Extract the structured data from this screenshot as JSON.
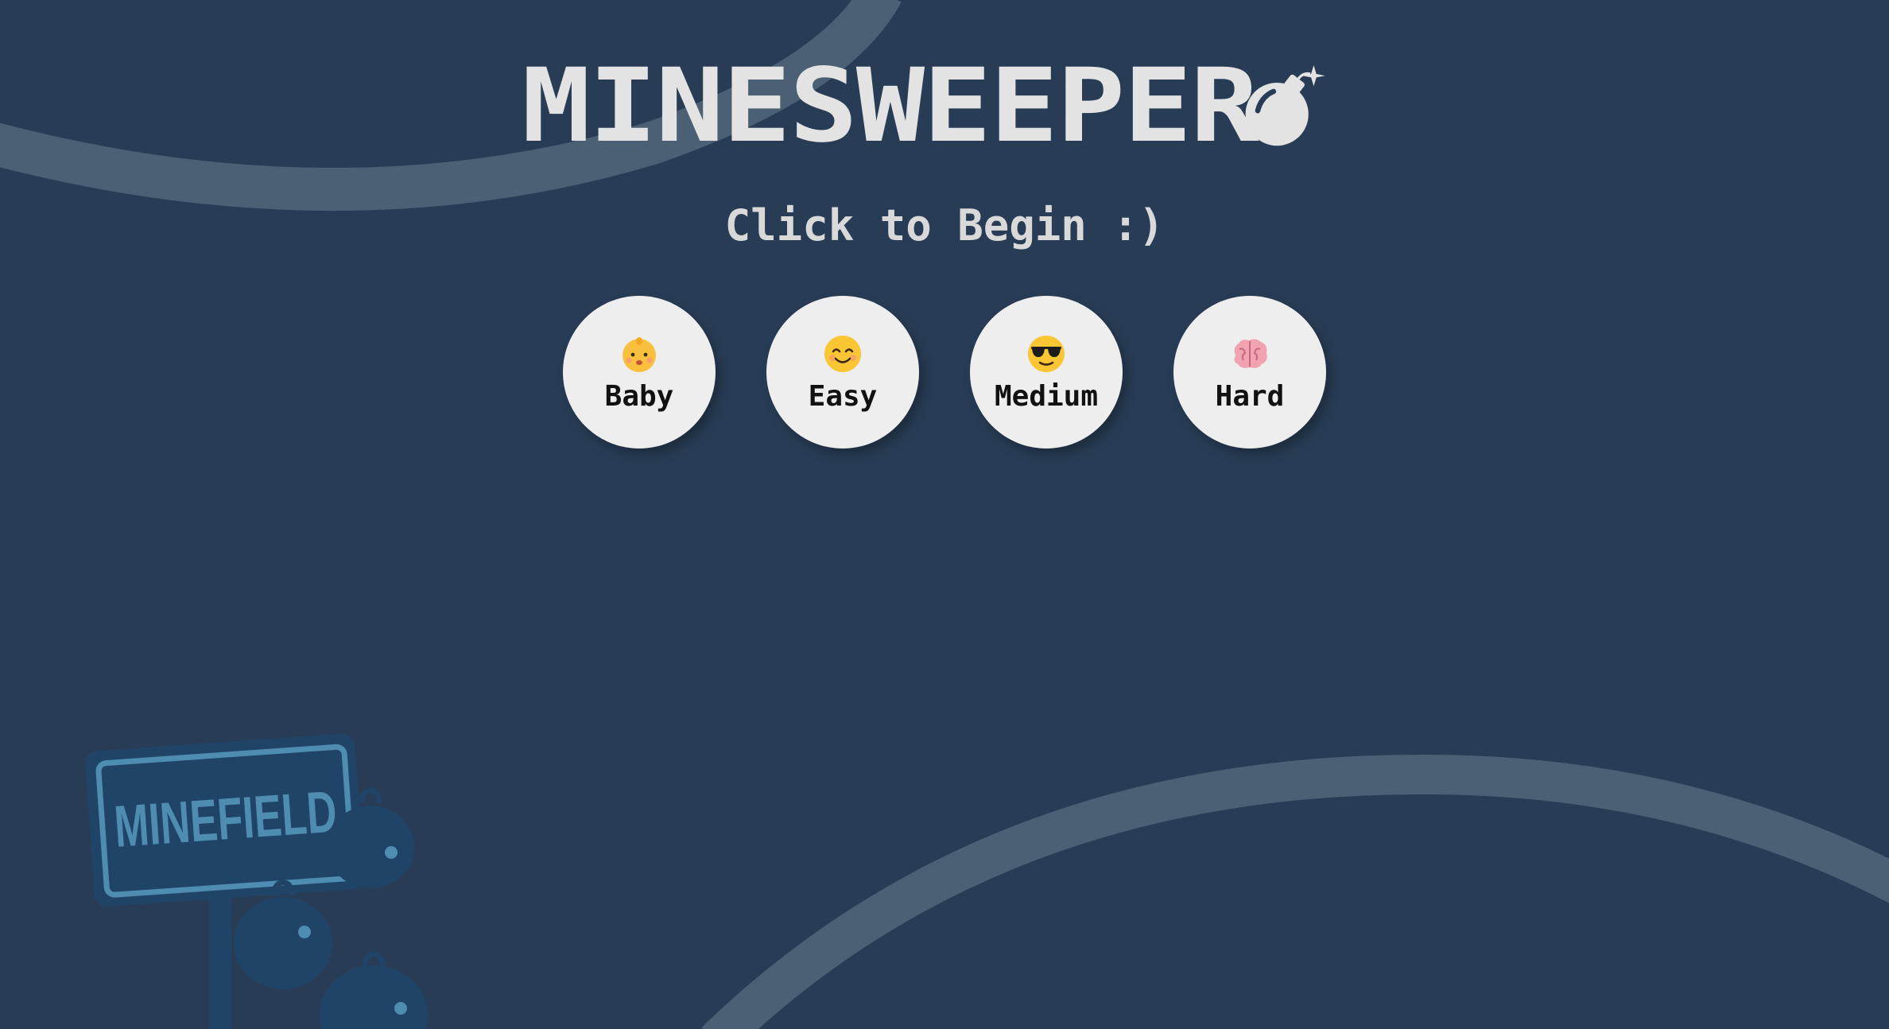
{
  "title": "MINESWEEPER",
  "subtitle": "Click to Begin :)",
  "difficulties": [
    {
      "label": "Baby",
      "icon": "baby-face-icon"
    },
    {
      "label": "Easy",
      "icon": "smiling-face-icon"
    },
    {
      "label": "Medium",
      "icon": "sunglasses-face-icon"
    },
    {
      "label": "Hard",
      "icon": "brain-icon"
    }
  ],
  "illustration": {
    "sign_text": "MINEFIELD"
  },
  "colors": {
    "background": "#283d55",
    "arc": "#4b6075",
    "title": "#e3e3e3",
    "button_bg": "#efeeef",
    "button_text": "#111111",
    "illustration": "#1f4468"
  }
}
